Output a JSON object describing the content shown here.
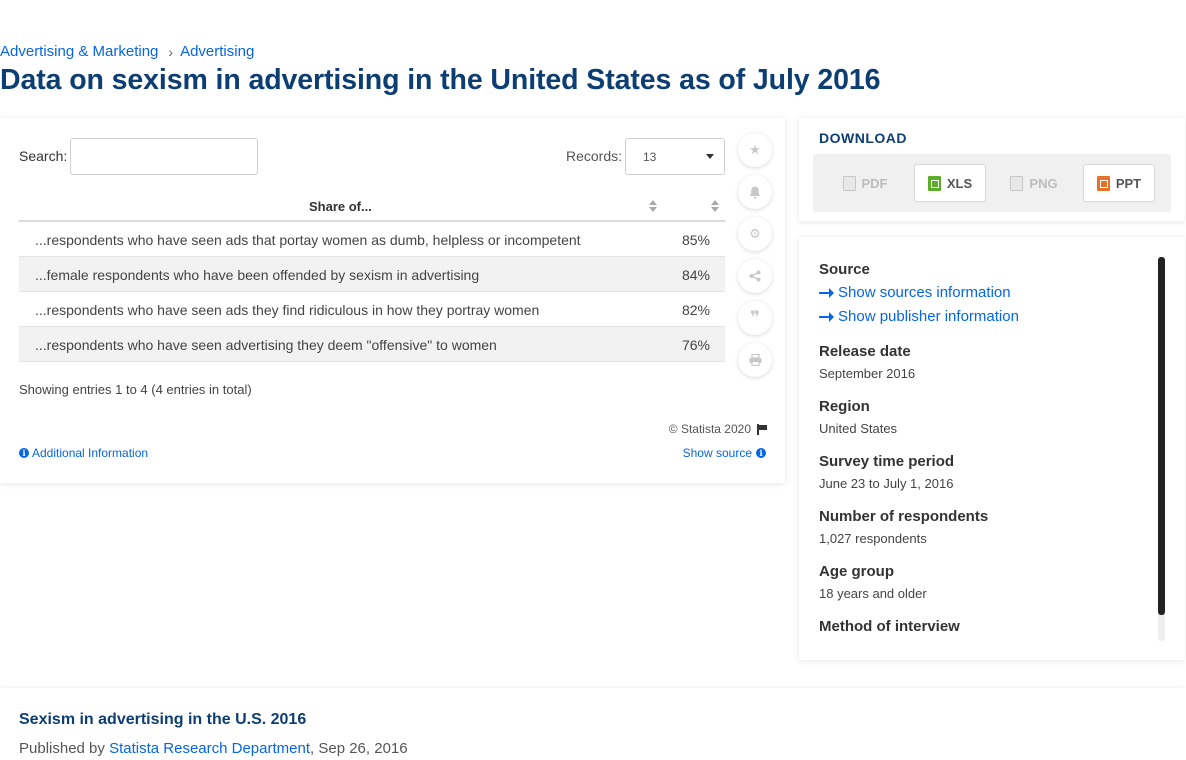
{
  "breadcrumb": {
    "items": [
      "Advertising & Marketing",
      "Advertising"
    ],
    "separator": "›"
  },
  "title": "Data on sexism in advertising in the United States as of July 2016",
  "table_controls": {
    "search_label": "Search:",
    "search_value": "",
    "records_label": "Records:",
    "records_value": "13"
  },
  "table": {
    "columns": [
      "Share of...",
      ""
    ],
    "rows": [
      {
        "label": "...respondents who have seen ads that portay women as dumb, helpless or incompetent",
        "value": "85%"
      },
      {
        "label": "...female respondents who have been offended by sexism in advertising",
        "value": "84%"
      },
      {
        "label": "...respondents who have seen ads they find ridiculous in how they portray women",
        "value": "82%"
      },
      {
        "label": "...respondents who have seen advertising they deem \"offensive\" to women",
        "value": "76%"
      }
    ]
  },
  "showing_text": "Showing entries 1 to 4 (4 entries in total)",
  "copyright": "© Statista 2020",
  "additional_info": "Additional Information",
  "show_source": "Show source",
  "tools": [
    "star-icon",
    "bell-icon",
    "gear-icon",
    "share-icon",
    "quote-icon",
    "print-icon"
  ],
  "download": {
    "title": "DOWNLOAD",
    "buttons": [
      {
        "label": "PDF",
        "enabled": false
      },
      {
        "label": "XLS",
        "enabled": true
      },
      {
        "label": "PNG",
        "enabled": false
      },
      {
        "label": "PPT",
        "enabled": true
      }
    ]
  },
  "info": {
    "source_heading": "Source",
    "show_sources": "Show sources information",
    "show_publisher": "Show publisher information",
    "release_heading": "Release date",
    "release_value": "September 2016",
    "region_heading": "Region",
    "region_value": "United States",
    "survey_heading": "Survey time period",
    "survey_value": "June 23 to July 1, 2016",
    "respondents_heading": "Number of respondents",
    "respondents_value": "1,027 respondents",
    "age_heading": "Age group",
    "age_value": "18 years and older",
    "method_heading": "Method of interview"
  },
  "bottom": {
    "title": "Sexism in advertising in the U.S. 2016",
    "published_prefix": "Published by",
    "publisher": "Statista Research Department",
    "date": ", Sep 26, 2016"
  },
  "colors": {
    "accent": "#0666e5",
    "title": "#0d3e73",
    "xls": "#5cae2a",
    "ppt": "#e8722a"
  }
}
